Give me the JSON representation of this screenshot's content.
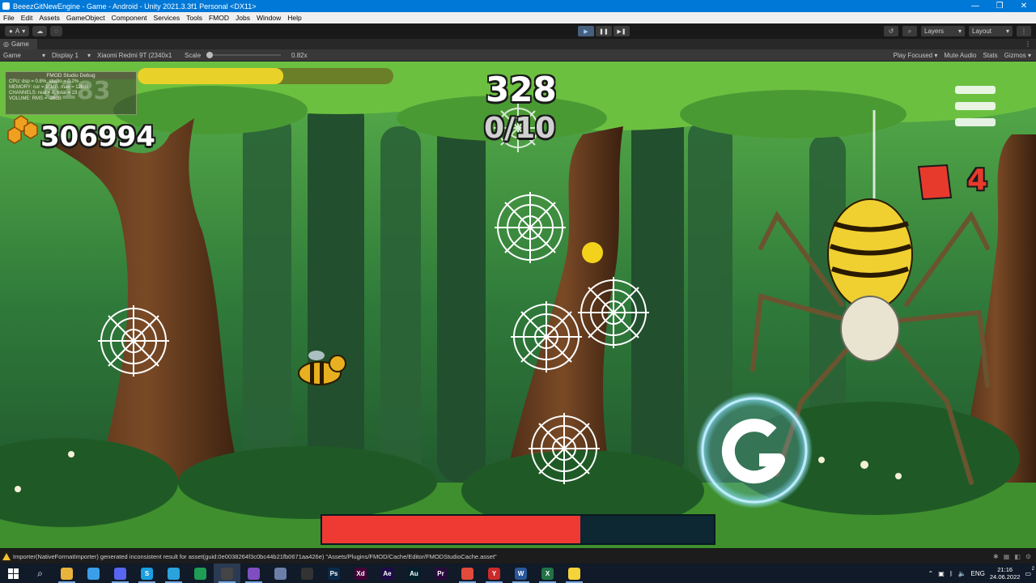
{
  "window": {
    "title": "BeeezGitNewEngine - Game - Android - Unity 2021.3.3f1 Personal <DX11>"
  },
  "menu": [
    "File",
    "Edit",
    "Assets",
    "GameObject",
    "Component",
    "Services",
    "Tools",
    "FMOD",
    "Jobs",
    "Window",
    "Help"
  ],
  "toolbar": {
    "account": "A",
    "layers": "Layers",
    "layout": "Layout"
  },
  "game_view": {
    "tab": "Game",
    "mode": "Game",
    "display": "Display 1",
    "device": "Xiaomi Redmi 9T (2340x1",
    "scale_label": "Scale",
    "scale_value": "0.82x",
    "play_focused": "Play Focused",
    "mute_audio": "Mute Audio",
    "stats": "Stats",
    "gizmos": "Gizmos"
  },
  "fmod_debug": {
    "title": "FMOD Studio Debug",
    "lines": [
      "CPU: dsp = 0.8%, studio = 0.2%",
      "MEMORY: cur = 10MB, max = 12MB",
      "CHANNELS: real = 8, total = 23",
      "VOLUME: RMS = -26dB"
    ],
    "overlay_score": "6183"
  },
  "hud": {
    "honey_score": "306994",
    "center_score": "328",
    "web_progress": "0/10",
    "lives": "4",
    "top_bar_fill": 0.57,
    "boss_health_fill": 0.66
  },
  "console": {
    "message": "Importer(NativeFormatImporter) generated inconsistent result for asset(guid:0e0038264f3c0bc44b21fb0671aa426e) \"Assets/Plugins/FMOD/Cache/Editor/FMODStudioCache.asset\""
  },
  "taskbar": {
    "apps": [
      {
        "name": "file-explorer",
        "glyph": "",
        "color": "#e8b33a"
      },
      {
        "name": "paint",
        "glyph": "",
        "color": "#3a9ee8"
      },
      {
        "name": "discord",
        "glyph": "",
        "color": "#5865f2"
      },
      {
        "name": "skype",
        "glyph": "S",
        "color": "#1a9fe0"
      },
      {
        "name": "telegram",
        "glyph": "",
        "color": "#2aa3dc"
      },
      {
        "name": "sheets",
        "glyph": "",
        "color": "#1f9c55"
      },
      {
        "name": "unity",
        "glyph": "",
        "color": "#444"
      },
      {
        "name": "visual-studio",
        "glyph": "",
        "color": "#7f4fc0"
      },
      {
        "name": "vmware",
        "glyph": "",
        "color": "#6b7fa8"
      },
      {
        "name": "github",
        "glyph": "",
        "color": "#333"
      },
      {
        "name": "photoshop",
        "glyph": "Ps",
        "color": "#0b2a4a"
      },
      {
        "name": "adobe-xd",
        "glyph": "Xd",
        "color": "#470137"
      },
      {
        "name": "after-effects",
        "glyph": "Ae",
        "color": "#1f0a49"
      },
      {
        "name": "audition",
        "glyph": "Au",
        "color": "#00202b"
      },
      {
        "name": "premiere",
        "glyph": "Pr",
        "color": "#2a0a3d"
      },
      {
        "name": "chrome",
        "glyph": "",
        "color": "#e24a3b"
      },
      {
        "name": "yandex-browser",
        "glyph": "Y",
        "color": "#cc2a2a"
      },
      {
        "name": "word",
        "glyph": "W",
        "color": "#2b579a"
      },
      {
        "name": "excel",
        "glyph": "X",
        "color": "#217346"
      },
      {
        "name": "sticky-notes",
        "glyph": "",
        "color": "#f5d33a"
      }
    ],
    "lang": "ENG",
    "time": "21:16",
    "date": "24.06.2022",
    "notifications": "2"
  },
  "colors": {
    "unity_accent": "#0078d7",
    "boss_bar": "#ef3a34",
    "lives_red": "#e83a2c"
  }
}
